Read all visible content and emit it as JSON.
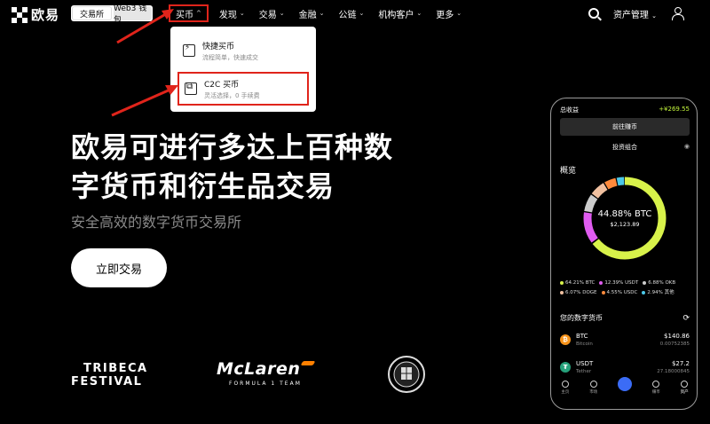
{
  "topbar": {
    "brand": "欧易",
    "toggle": {
      "exchange": "交易所",
      "wallet": "Web3 钱包"
    },
    "nav": [
      {
        "label": "买币",
        "caret": "^"
      },
      {
        "label": "发现",
        "caret": "⌄"
      },
      {
        "label": "交易",
        "caret": "⌄"
      },
      {
        "label": "金融",
        "caret": "⌄"
      },
      {
        "label": "公链",
        "caret": "⌄"
      },
      {
        "label": "机构客户",
        "caret": "⌄"
      },
      {
        "label": "更多",
        "caret": "⌄"
      }
    ],
    "asset_manage": "资产管理",
    "icons": [
      "search-icon",
      "user-icon"
    ]
  },
  "dropdown": {
    "items": [
      {
        "title": "快捷买币",
        "subtitle": "流程简单，快速成交",
        "icon": "lightning-card-icon"
      },
      {
        "title": "C2C 买币",
        "subtitle": "灵活选择，0 手续费",
        "icon": "people-exchange-icon"
      }
    ]
  },
  "hero": {
    "title_line1": "欧易可进行多达上百种数",
    "title_line2": "字货币和衍生品交易",
    "subtitle": "安全高效的数字货币交易所",
    "cta": "立即交易"
  },
  "partners": {
    "tribeca_line1": "TRIBECA",
    "tribeca_line2": "FESTIVAL",
    "mclaren_name": "McLaren",
    "mclaren_sub": "FORMULA 1 TEAM"
  },
  "phone": {
    "total_label": "总收益",
    "total_value": "+¥269.55",
    "earn_button": "前往赚币",
    "portfolio": "投资组合",
    "overview": "概览",
    "donut_pct": "44.88% BTC",
    "donut_amount": "$2,123.89",
    "allocation": [
      {
        "label": "64.21% BTC",
        "color": "#d8f24a"
      },
      {
        "label": "12.39% USDT",
        "color": "#e05cf0"
      },
      {
        "label": "6.88% OKB",
        "color": "#cccccc"
      },
      {
        "label": "6.07% DOGE",
        "color": "#f0c0a0"
      },
      {
        "label": "4.55% USDC",
        "color": "#ff8a3c"
      },
      {
        "label": "2.94% 其他",
        "color": "#4cc8e8"
      }
    ],
    "holdings_title": "您的数字货币",
    "assets": [
      {
        "symbol": "BTC",
        "name": "Bitcoin",
        "value": "$140.86",
        "qty": "0.00752385"
      },
      {
        "symbol": "USDT",
        "name": "Tether",
        "value": "$27.2",
        "qty": "27.18000845"
      }
    ],
    "tabs": [
      "主页",
      "市场",
      "",
      "赚币",
      "资产"
    ]
  },
  "colors": {
    "accent": "#e0241b",
    "lime": "#c3f53c",
    "background": "#000000"
  }
}
